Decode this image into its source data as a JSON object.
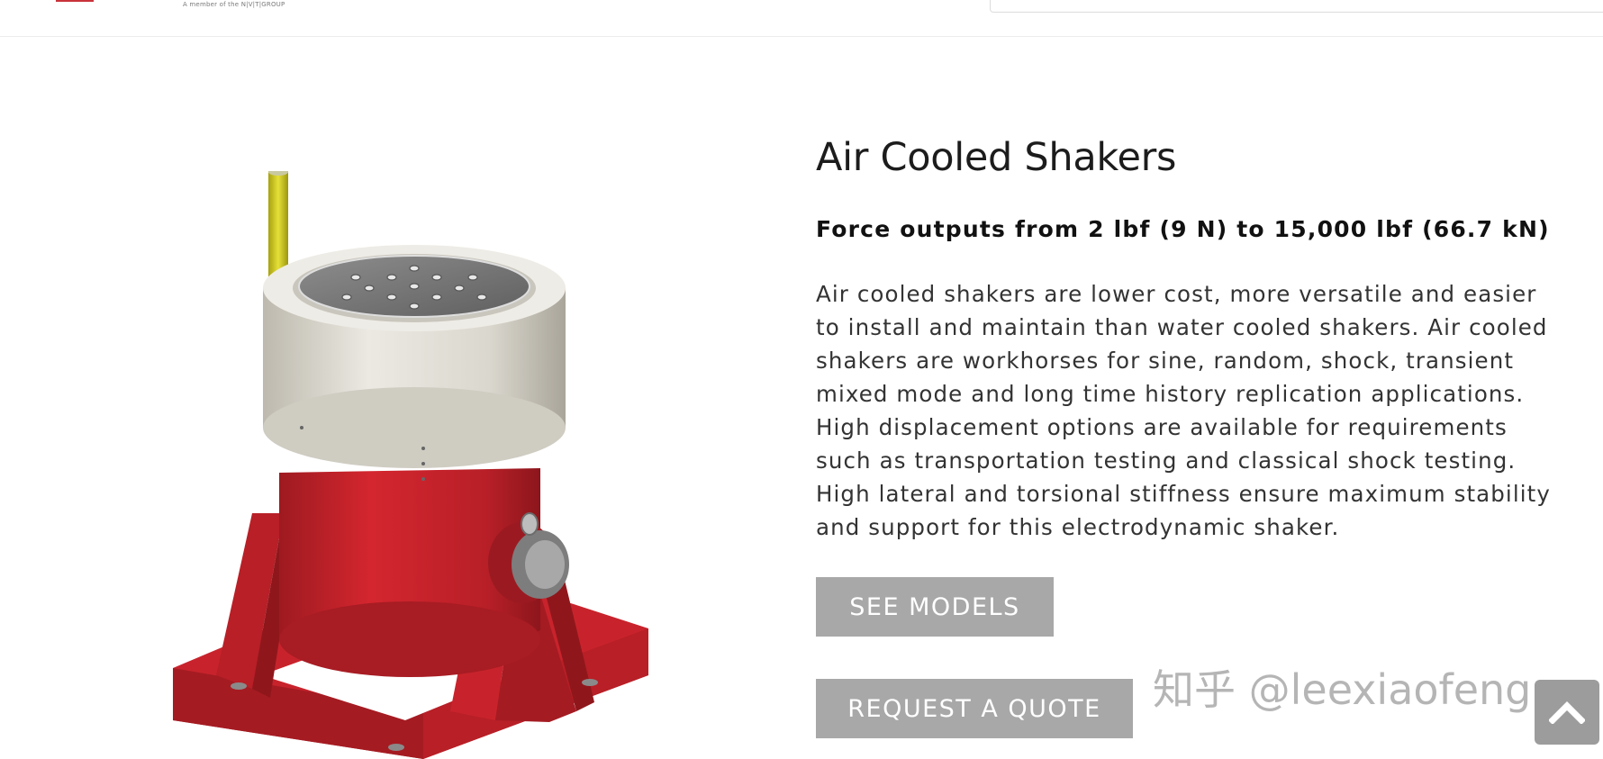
{
  "header": {
    "tagline": "A member of the N|V|T|GROUP"
  },
  "product": {
    "title": "Air Cooled Shakers",
    "subtitle": "Force outputs from 2 lbf (9 N) to 15,000 lbf (66.7 kN)",
    "description": "Air cooled shakers are lower cost, more versatile and easier to install and maintain than water cooled shakers. Air cooled shakers are workhorses for sine, random, shock, transient mixed mode and long time history replication applications. High displacement options are available for requirements such as transportation testing and classical shock testing. High lateral and torsional stiffness ensure maximum stability and support for this electrodynamic shaker."
  },
  "actions": {
    "see_models": "SEE MODELS",
    "request_quote": "REQUEST A QUOTE"
  },
  "watermark": "知乎 @leexiaofeng",
  "colors": {
    "button_bg": "#a8a8a8",
    "button_text": "#ffffff",
    "shaker_red": "#c8232c",
    "shaker_body": "#dcdad3",
    "accent_yellow": "#d8d21c"
  },
  "icons": {
    "scroll_top": "chevron-up-icon"
  }
}
